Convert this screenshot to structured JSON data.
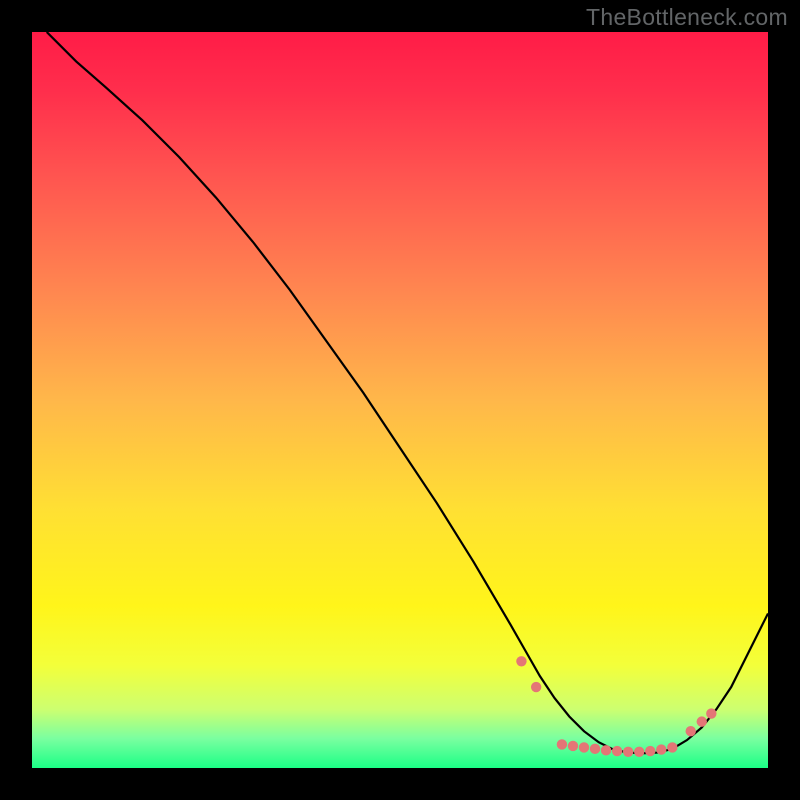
{
  "watermark": "TheBottleneck.com",
  "colors": {
    "marker": "#e47676",
    "curve": "#000000"
  },
  "chart_data": {
    "type": "line",
    "title": "",
    "xlabel": "",
    "ylabel": "",
    "xlim": [
      0,
      100
    ],
    "ylim": [
      0,
      100
    ],
    "grid": false,
    "legend": false,
    "x": [
      2,
      6,
      10,
      15,
      20,
      25,
      30,
      35,
      40,
      45,
      50,
      55,
      60,
      65,
      67,
      69,
      71,
      73,
      75,
      77,
      79,
      81,
      83,
      85,
      87,
      89,
      91,
      93,
      95,
      97,
      100
    ],
    "y": [
      100,
      96,
      92.5,
      88,
      83,
      77.5,
      71.5,
      65,
      58,
      51,
      43.5,
      36,
      28,
      19.5,
      16,
      12.5,
      9.5,
      7,
      5,
      3.5,
      2.5,
      2.1,
      2.0,
      2.1,
      2.6,
      3.8,
      5.5,
      8,
      11,
      15,
      21
    ],
    "marker_points": [
      {
        "x": 66.5,
        "y": 14.5
      },
      {
        "x": 68.5,
        "y": 11.0
      },
      {
        "x": 72.0,
        "y": 3.2
      },
      {
        "x": 73.5,
        "y": 3.0
      },
      {
        "x": 75.0,
        "y": 2.8
      },
      {
        "x": 76.5,
        "y": 2.6
      },
      {
        "x": 78.0,
        "y": 2.4
      },
      {
        "x": 79.5,
        "y": 2.3
      },
      {
        "x": 81.0,
        "y": 2.2
      },
      {
        "x": 82.5,
        "y": 2.2
      },
      {
        "x": 84.0,
        "y": 2.3
      },
      {
        "x": 85.5,
        "y": 2.5
      },
      {
        "x": 87.0,
        "y": 2.8
      },
      {
        "x": 89.5,
        "y": 5.0
      },
      {
        "x": 91.0,
        "y": 6.3
      },
      {
        "x": 92.3,
        "y": 7.4
      }
    ]
  }
}
